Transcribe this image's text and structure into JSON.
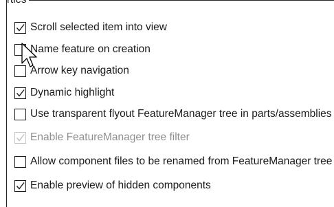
{
  "group": {
    "title": "rties"
  },
  "options": [
    {
      "label": "Scroll selected item into view",
      "checked": true,
      "enabled": true
    },
    {
      "label": "Name feature on creation",
      "checked": false,
      "enabled": true
    },
    {
      "label": "Arrow key navigation",
      "checked": false,
      "enabled": true
    },
    {
      "label": "Dynamic highlight",
      "checked": true,
      "enabled": true
    },
    {
      "label": "Use transparent flyout FeatureManager tree in parts/assemblies",
      "checked": false,
      "enabled": true
    },
    {
      "label": "Enable FeatureManager tree filter",
      "checked": true,
      "enabled": false
    },
    {
      "label": "Allow component files to be renamed from FeatureManager tree",
      "checked": false,
      "enabled": true
    },
    {
      "label": "Enable preview of hidden components",
      "checked": true,
      "enabled": true
    }
  ],
  "cursor": {
    "icon": "arrow-pointer-icon"
  }
}
